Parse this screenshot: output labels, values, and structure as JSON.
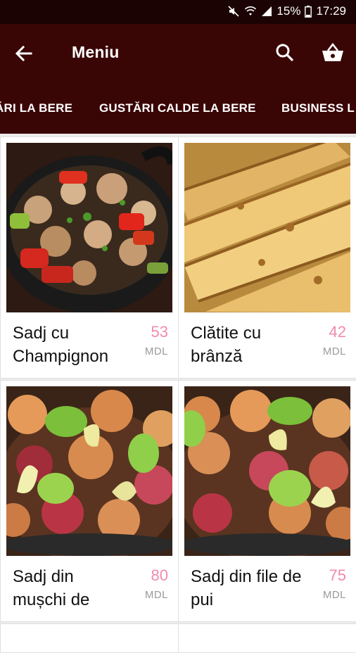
{
  "status": {
    "battery": "15%",
    "time": "17:29"
  },
  "appbar": {
    "title": "Meniu"
  },
  "tabs": [
    "ĂRI LA BERE",
    "GUSTĂRI CALDE LA BERE",
    "BUSINESS L"
  ],
  "products": [
    {
      "name": "Sadj cu Champignon",
      "price": "53",
      "currency": "MDL",
      "image": "sadj-champignon-photo"
    },
    {
      "name": "Clătite cu brânză",
      "price": "42",
      "currency": "MDL",
      "image": "clatite-branza-photo"
    },
    {
      "name": "Sadj din mușchi de",
      "price": "80",
      "currency": "MDL",
      "image": "sadj-muschi-photo"
    },
    {
      "name": "Sadj din file de pui",
      "price": "75",
      "currency": "MDL",
      "image": "sadj-pui-photo"
    }
  ],
  "colors": {
    "status_bar": "#1c0303",
    "app_bar": "#3a0505",
    "price": "#f18ba9",
    "background": "#ececec"
  }
}
